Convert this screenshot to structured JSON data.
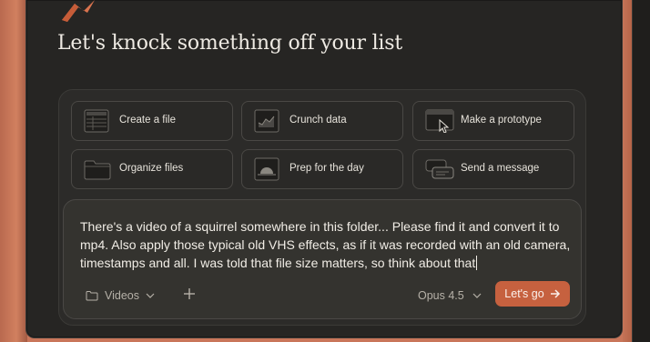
{
  "header": {
    "title": "Let's knock something off your list"
  },
  "suggestions": [
    {
      "label": "Create a file",
      "icon": "spreadsheet-icon"
    },
    {
      "label": "Crunch data",
      "icon": "chart-icon"
    },
    {
      "label": "Make a prototype",
      "icon": "window-cursor-icon"
    },
    {
      "label": "Organize files",
      "icon": "folder-icon"
    },
    {
      "label": "Prep for the day",
      "icon": "sunrise-icon"
    },
    {
      "label": "Send a message",
      "icon": "chat-bubbles-icon"
    }
  ],
  "composer": {
    "prompt_text": "There's a video of a squirrel somewhere in this folder... Please find it and convert it to mp4. Also apply those typical old VHS effects, as if it was recorded with an old camera, timestamps and all. I was told that file size matters, so think about that",
    "folder_label": "Videos",
    "model_label": "Opus 4.5",
    "submit_label": "Let's go"
  },
  "colors": {
    "accent": "#c6613f",
    "background": "#262523",
    "backdrop": "#c9765a"
  }
}
